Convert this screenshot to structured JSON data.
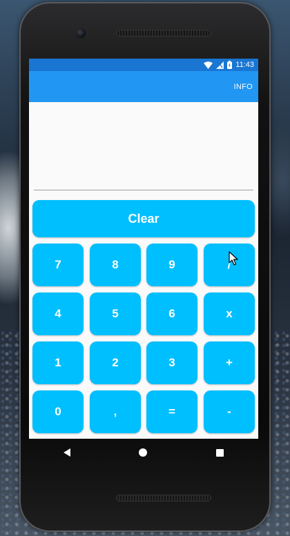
{
  "status": {
    "time": "11:43"
  },
  "toolbar": {
    "action_label": "INFO"
  },
  "display": {
    "value": ""
  },
  "keys": {
    "clear": "Clear",
    "rows": [
      [
        "7",
        "8",
        "9",
        "/"
      ],
      [
        "4",
        "5",
        "6",
        "x"
      ],
      [
        "1",
        "2",
        "3",
        "+"
      ],
      [
        "0",
        ",",
        "=",
        "-"
      ]
    ]
  },
  "colors": {
    "status_bar": "#1976d2",
    "toolbar": "#2196f3",
    "key": "#00bfff"
  }
}
